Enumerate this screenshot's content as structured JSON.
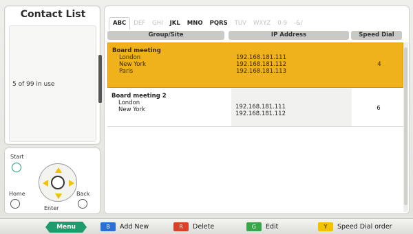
{
  "sidebar": {
    "title": "Contact List",
    "usage": "5 of 99 in use"
  },
  "remote": {
    "start": "Start",
    "home": "Home",
    "back": "Back",
    "enter": "Enter"
  },
  "tabs": [
    {
      "label": "ABC",
      "state": "active"
    },
    {
      "label": "DEF",
      "state": "dim"
    },
    {
      "label": "GHI",
      "state": "dim"
    },
    {
      "label": "JKL",
      "state": "normal"
    },
    {
      "label": "MNO",
      "state": "normal"
    },
    {
      "label": "PQRS",
      "state": "normal"
    },
    {
      "label": "TUV",
      "state": "dim"
    },
    {
      "label": "WXYZ",
      "state": "dim"
    },
    {
      "label": "0-9",
      "state": "dim"
    },
    {
      "label": "-&/",
      "state": "dim"
    }
  ],
  "columns": {
    "group": "Group/Site",
    "ip": "IP Address",
    "speed": "Speed Dial"
  },
  "rows": [
    {
      "title": "Board meeting",
      "sites": [
        "London",
        "New York",
        "Paris"
      ],
      "ips": [
        "192.168.181.111",
        "192.168.181.112",
        "192.168.181.113"
      ],
      "speed": "4"
    },
    {
      "title": "Board meeting 2",
      "sites": [
        "London",
        "New York"
      ],
      "ips": [
        "192.168.181.111",
        "192.168.181.112"
      ],
      "speed": "6"
    }
  ],
  "bottom": {
    "menu": "Menu",
    "blue_key": "B",
    "blue_label": "Add New",
    "red_key": "R",
    "red_label": "Delete",
    "green_key": "G",
    "green_label": "Edit",
    "yellow_key": "Y",
    "yellow_label": "Speed Dial order"
  },
  "colors": {
    "selected_row": "#f0b21a",
    "menu_green": "#1e9c6c",
    "key_blue": "#2a6fd6",
    "key_red": "#d9402b",
    "key_green": "#3aa64a",
    "key_yellow": "#f2c200"
  }
}
